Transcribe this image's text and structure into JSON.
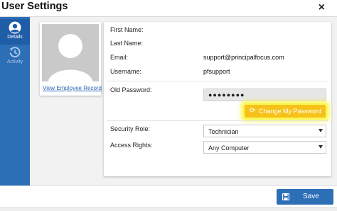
{
  "window": {
    "title": "User Settings",
    "close_glyph": "×"
  },
  "sidebar": {
    "items": [
      {
        "label": "Details",
        "icon": "user-circle-icon",
        "active": true
      },
      {
        "label": "Activity",
        "icon": "history-icon",
        "active": false
      }
    ]
  },
  "profile": {
    "photo_icon": "avatar-placeholder-icon",
    "record_link": "View Employee Record"
  },
  "form": {
    "first_name_label": "First Name:",
    "first_name_value": "",
    "last_name_label": "Last Name:",
    "last_name_value": "",
    "email_label": "Email:",
    "email_value": "support@principalfocus.com",
    "username_label": "Username:",
    "username_value": "pfsupport",
    "old_password_label": "Old Password:",
    "old_password_value": "●●●●●●●●",
    "change_password_label": "Change My Password",
    "change_password_icon": "refresh-icon",
    "security_role_label": "Security Role:",
    "security_role_value": "Technician",
    "access_rights_label": "Access Rights:",
    "access_rights_value": "Any Computer"
  },
  "footer": {
    "save_label": "Save",
    "save_icon": "floppy-disk-icon"
  },
  "colors": {
    "primary": "#2d6fb7",
    "highlight": "#f6c21a",
    "glow": "#faf53c"
  }
}
